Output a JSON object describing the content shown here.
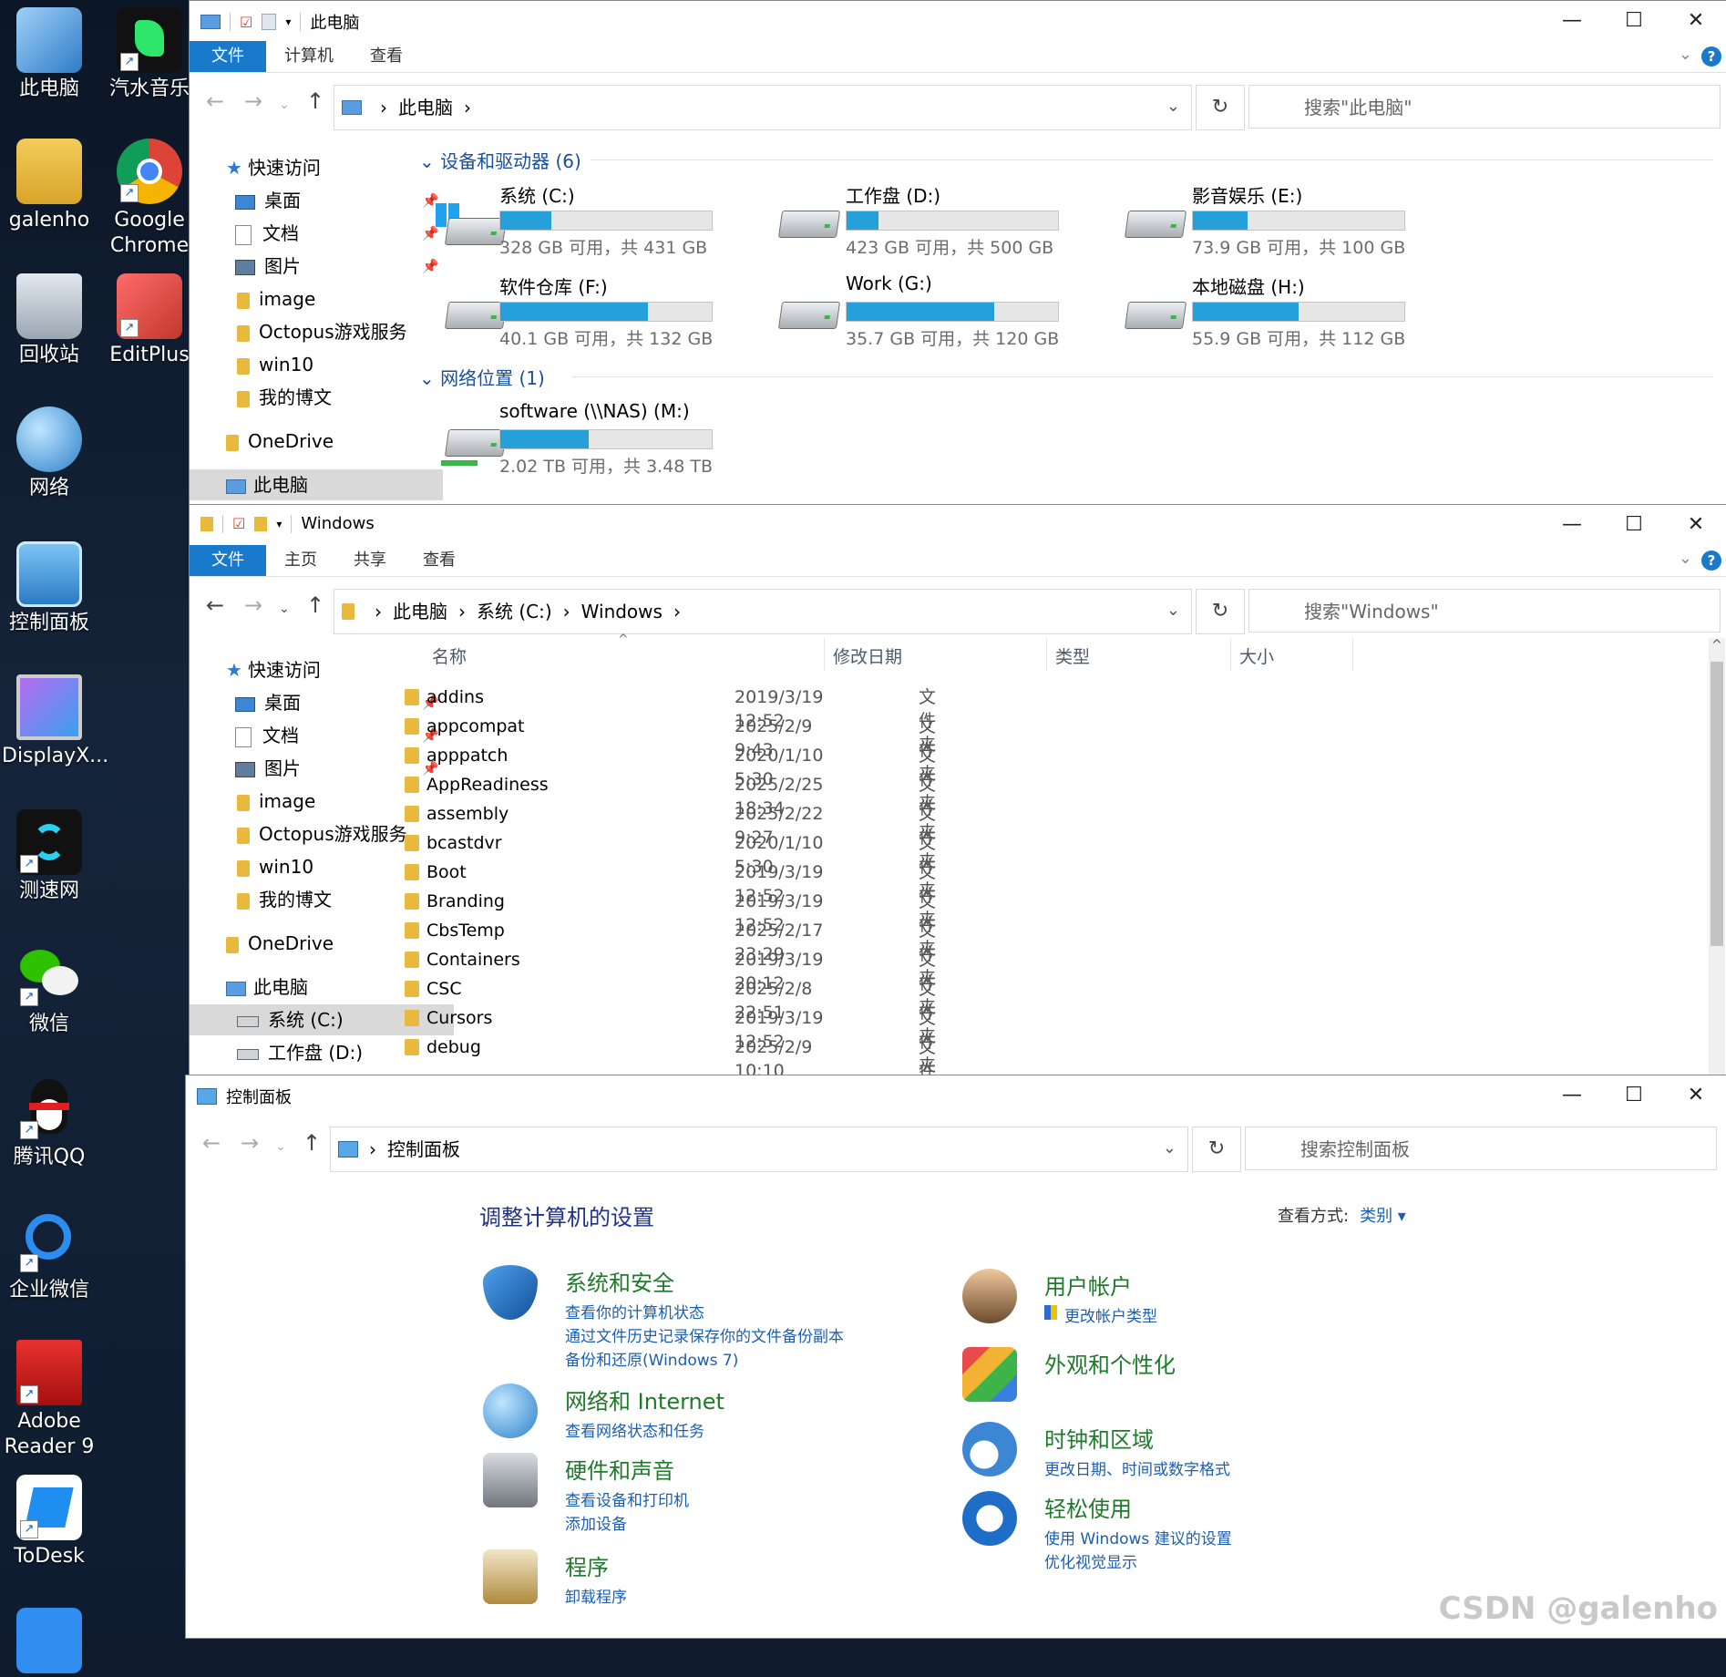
{
  "desktop": {
    "icons": [
      {
        "label": "此电脑"
      },
      {
        "label": "汽水音乐"
      },
      {
        "label": "galenho"
      },
      {
        "label": "Google\nChrome"
      },
      {
        "label": "回收站"
      },
      {
        "label": "EditPlus"
      },
      {
        "label": "网络"
      },
      {
        "label": "控制面板"
      },
      {
        "label": "DisplayX..."
      },
      {
        "label": "测速网"
      },
      {
        "label": "微信"
      },
      {
        "label": "腾讯QQ"
      },
      {
        "label": "企业微信"
      },
      {
        "label": "Adobe\nReader 9"
      },
      {
        "label": "ToDesk"
      }
    ]
  },
  "win1": {
    "title": "此电脑",
    "tabs": [
      "文件",
      "计算机",
      "查看"
    ],
    "breadcrumb": [
      "此电脑"
    ],
    "search_placeholder": "搜索\"此电脑\"",
    "nav": {
      "quick_access": "快速访问",
      "desktop": "桌面",
      "docs": "文档",
      "pics": "图片",
      "image": "image",
      "octopus": "Octopus游戏服务",
      "win10": "win10",
      "blog": "我的博文",
      "onedrive": "OneDrive",
      "pc": "此电脑"
    },
    "group_devices": "设备和驱动器 (6)",
    "group_network": "网络位置 (1)",
    "drives": [
      {
        "name": "系统 (C:)",
        "free": "328 GB 可用，共 431 GB",
        "used_fraction": 0.24,
        "system": true
      },
      {
        "name": "工作盘 (D:)",
        "free": "423 GB 可用，共 500 GB",
        "used_fraction": 0.15
      },
      {
        "name": "影音娱乐 (E:)",
        "free": "73.9 GB 可用，共 100 GB",
        "used_fraction": 0.26
      },
      {
        "name": "软件仓库 (F:)",
        "free": "40.1 GB 可用，共 132 GB",
        "used_fraction": 0.7
      },
      {
        "name": "Work (G:)",
        "free": "35.7 GB 可用，共 120 GB",
        "used_fraction": 0.7
      },
      {
        "name": "本地磁盘 (H:)",
        "free": "55.9 GB 可用，共 112 GB",
        "used_fraction": 0.5
      }
    ],
    "network_drive": {
      "name": "software (\\\\NAS) (M:)",
      "free": "2.02 TB 可用，共 3.48 TB",
      "used_fraction": 0.42
    }
  },
  "win2": {
    "title": "Windows",
    "tabs": [
      "文件",
      "主页",
      "共享",
      "查看"
    ],
    "breadcrumb": [
      "此电脑",
      "系统 (C:)",
      "Windows"
    ],
    "search_placeholder": "搜索\"Windows\"",
    "nav": {
      "quick_access": "快速访问",
      "desktop": "桌面",
      "docs": "文档",
      "pics": "图片",
      "image": "image",
      "octopus": "Octopus游戏服务",
      "win10": "win10",
      "blog": "我的博文",
      "onedrive": "OneDrive",
      "pc": "此电脑",
      "c": "系统 (C:)",
      "d": "工作盘 (D:)"
    },
    "columns": {
      "name": "名称",
      "date": "修改日期",
      "type": "类型",
      "size": "大小"
    },
    "files": [
      {
        "name": "addins",
        "date": "2019/3/19 12:52",
        "type": "文件夹"
      },
      {
        "name": "appcompat",
        "date": "2025/2/9 9:43",
        "type": "文件夹"
      },
      {
        "name": "apppatch",
        "date": "2020/1/10 5:30",
        "type": "文件夹"
      },
      {
        "name": "AppReadiness",
        "date": "2025/2/25 18:34",
        "type": "文件夹"
      },
      {
        "name": "assembly",
        "date": "2025/2/22 9:27",
        "type": "文件夹"
      },
      {
        "name": "bcastdvr",
        "date": "2020/1/10 5:30",
        "type": "文件夹"
      },
      {
        "name": "Boot",
        "date": "2019/3/19 12:52",
        "type": "文件夹"
      },
      {
        "name": "Branding",
        "date": "2019/3/19 12:52",
        "type": "文件夹"
      },
      {
        "name": "CbsTemp",
        "date": "2025/2/17 23:29",
        "type": "文件夹"
      },
      {
        "name": "Containers",
        "date": "2019/3/19 20:12",
        "type": "文件夹"
      },
      {
        "name": "CSC",
        "date": "2025/2/8 22:51",
        "type": "文件夹"
      },
      {
        "name": "Cursors",
        "date": "2019/3/19 12:52",
        "type": "文件夹"
      },
      {
        "name": "debug",
        "date": "2025/2/9 10:10",
        "type": "文件夹"
      }
    ]
  },
  "win3": {
    "title": "控制面板",
    "breadcrumb": [
      "控制面板"
    ],
    "search_placeholder": "搜索控制面板",
    "heading": "调整计算机的设置",
    "view_by": "查看方式:",
    "view_mode": "类别 ▾",
    "categories_left": [
      {
        "title": "系统和安全",
        "links": [
          "查看你的计算机状态",
          "通过文件历史记录保存你的文件备份副本",
          "备份和还原(Windows 7)"
        ]
      },
      {
        "title": "网络和 Internet",
        "links": [
          "查看网络状态和任务"
        ]
      },
      {
        "title": "硬件和声音",
        "links": [
          "查看设备和打印机",
          "添加设备"
        ]
      },
      {
        "title": "程序",
        "links": [
          "卸载程序"
        ]
      }
    ],
    "categories_right": [
      {
        "title": "用户帐户",
        "links": [
          "更改帐户类型"
        ]
      },
      {
        "title": "外观和个性化",
        "links": []
      },
      {
        "title": "时钟和区域",
        "links": [
          "更改日期、时间或数字格式"
        ]
      },
      {
        "title": "轻松使用",
        "links": [
          "使用 Windows 建议的设置",
          "优化视觉显示"
        ]
      }
    ]
  },
  "watermark": "CSDN @galenho",
  "colors": {
    "accent": "#1979ca",
    "bar_fill": "#26a0da",
    "cp_green": "#1f7a2a",
    "link_blue": "#1a5fb4"
  },
  "icons": {
    "back": "←",
    "forward": "→",
    "up": "↑",
    "refresh": "↻",
    "minimize": "—",
    "maximize": "☐",
    "close": "✕",
    "help": "?"
  }
}
